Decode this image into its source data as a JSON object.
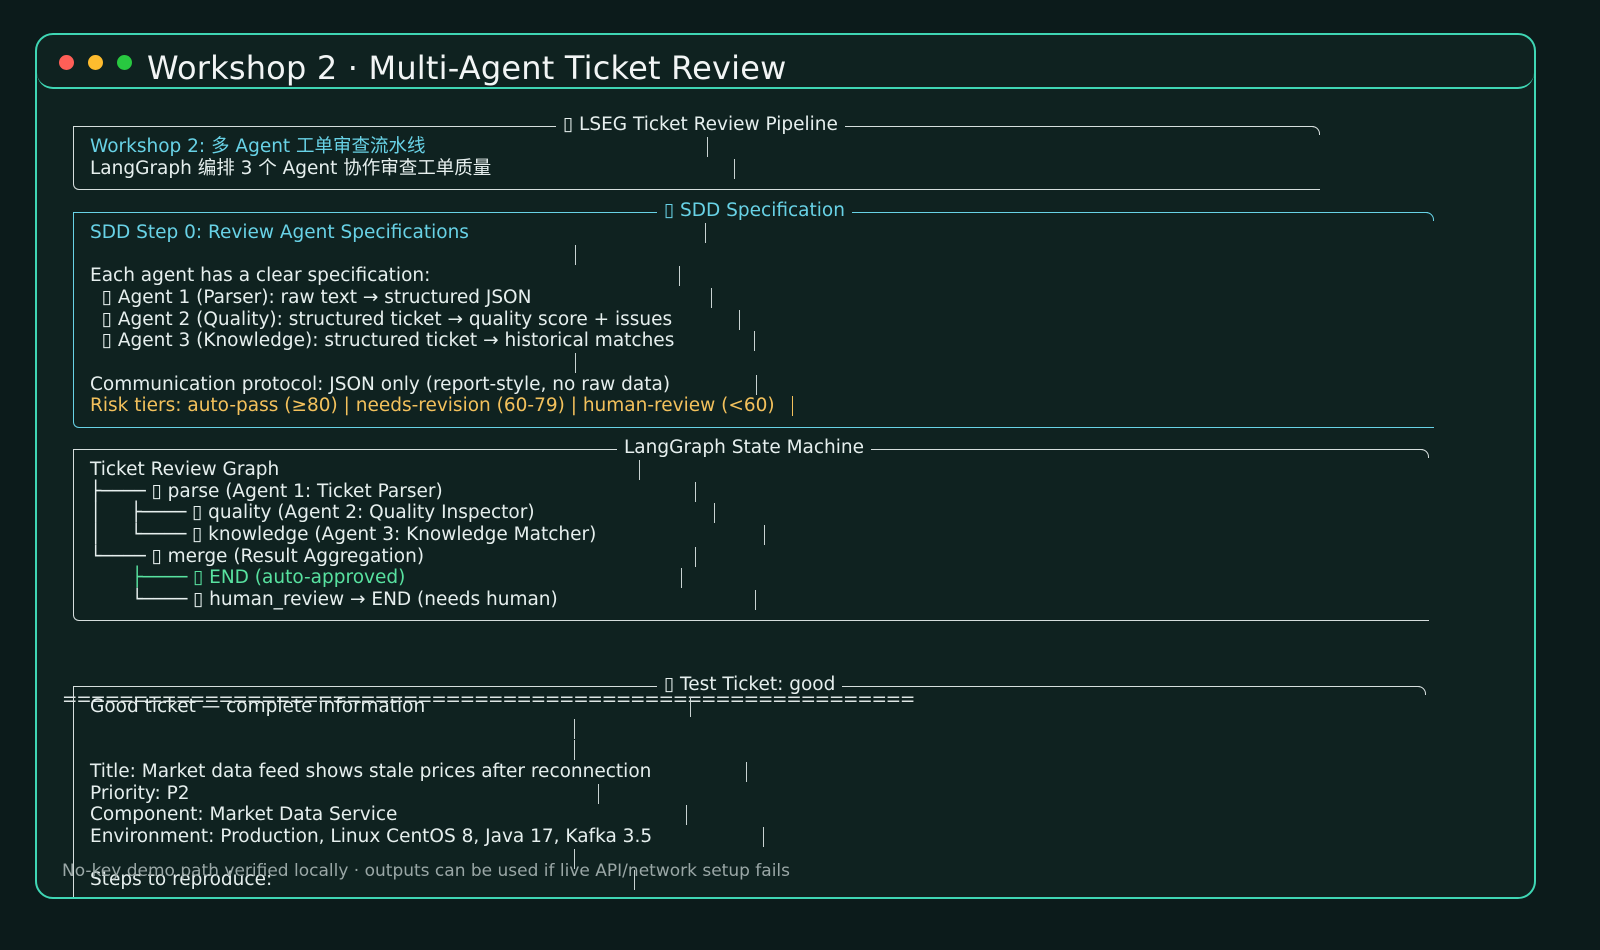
{
  "window": {
    "title": "Workshop 2 · Multi-Agent Ticket Review"
  },
  "pipeline_panel": {
    "title": "▯ LSEG Ticket Review Pipeline",
    "lines": [
      "Workshop 2: 多 Agent 工单审查流水线",
      "LangGraph 编排 3 个 Agent 协作审查工单质量"
    ]
  },
  "sdd_panel": {
    "title": "▯ SDD Specification",
    "lines": [
      "SDD Step 0: Review Agent Specifications",
      "",
      "Each agent has a clear specification:",
      "  ▯ Agent 1 (Parser): raw text → structured JSON",
      "  ▯ Agent 2 (Quality): structured ticket → quality score + issues",
      "  ▯ Agent 3 (Knowledge): structured ticket → historical matches",
      "",
      "Communication protocol: JSON only (report-style, no raw data)",
      "Risk tiers: auto-pass (≥80) | needs-revision (60-79) | human-review (<60)"
    ]
  },
  "graph_panel": {
    "title": "LangGraph State Machine",
    "lines": [
      "Ticket Review Graph",
      "├──── ▯ parse (Agent 1: Ticket Parser)",
      "│     ├──── ▯ quality (Agent 2: Quality Inspector)",
      "│     └──── ▯ knowledge (Agent 3: Knowledge Matcher)",
      "└──── ▯ merge (Result Aggregation)",
      "    ├──── ▯ END (auto-approved)",
      "    └──── ▯ human_review → END (needs human)"
    ]
  },
  "separator": "============================================================",
  "ticket_panel": {
    "title": "▯ Test Ticket: good",
    "lines": [
      "Good ticket — complete information",
      "",
      "",
      "Title: Market data feed shows stale prices after reconnection",
      "Priority: P2",
      "Component: Market Data Service",
      "Environment: Production, Linux CentOS 8, Java 17, Kafka 3.5",
      "",
      "Steps to reproduce:"
    ]
  },
  "footer": "No-key demo path verified locally · outputs can be used if live API/network setup fails"
}
